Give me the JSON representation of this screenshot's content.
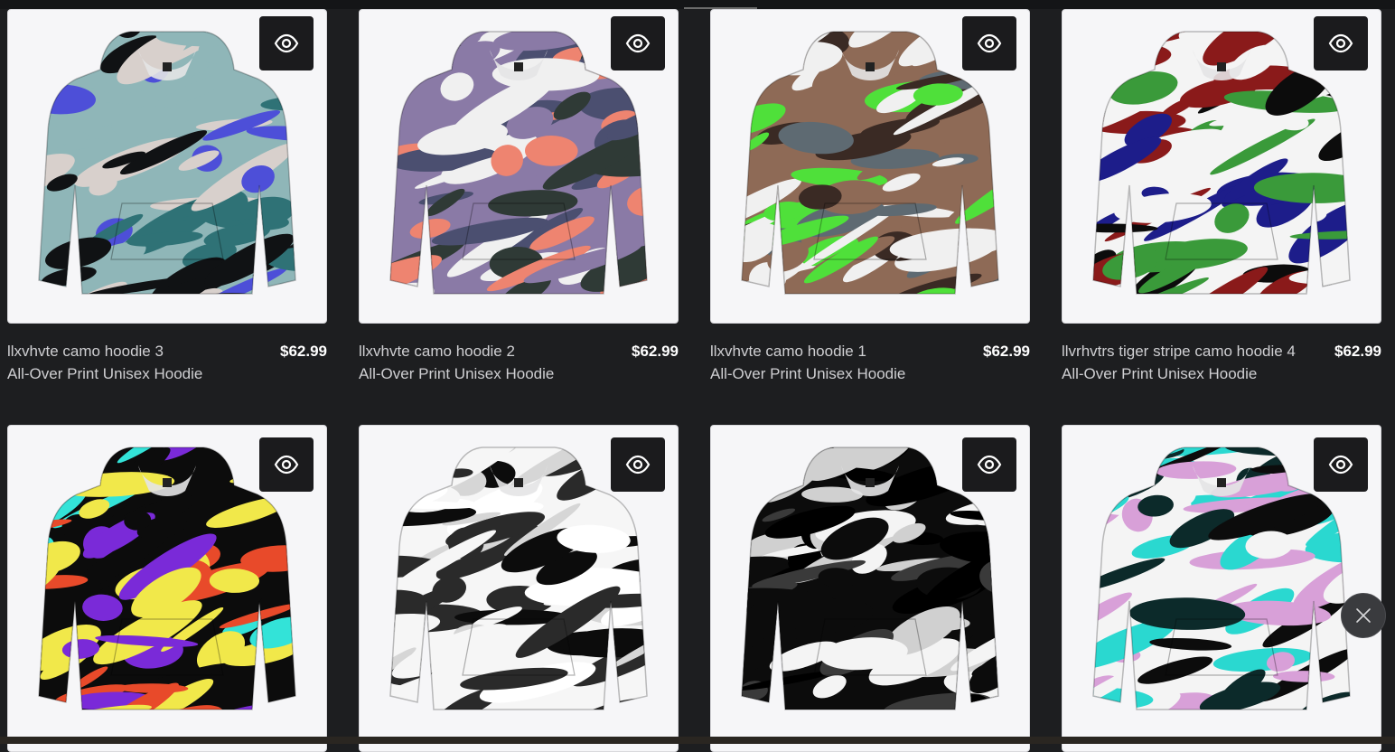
{
  "products": [
    {
      "name": "llxvhvte camo hoodie 3",
      "price": "$62.99",
      "type": "All-Over Print Unisex Hoodie",
      "colors": [
        "#8fb6b8",
        "#4d4fd8",
        "#d8d0cc",
        "#2f7276",
        "#101214"
      ]
    },
    {
      "name": "llxvhvte camo hoodie 2",
      "price": "$62.99",
      "type": "All-Over Print Unisex Hoodie",
      "colors": [
        "#8a7aa6",
        "#ee8470",
        "#2f3a36",
        "#4b4f70",
        "#f0f0f0"
      ]
    },
    {
      "name": "llxvhvte camo hoodie 1",
      "price": "$62.99",
      "type": "All-Over Print Unisex Hoodie",
      "colors": [
        "#8e6a56",
        "#4fe03a",
        "#3a2a24",
        "#5e6a72",
        "#f0f0f0"
      ]
    },
    {
      "name": "llvrhvtrs tiger stripe camo hoodie 4",
      "price": "$62.99",
      "type": "All-Over Print Unisex Hoodie",
      "colors": [
        "#f4f4f4",
        "#1d1d8a",
        "#3a9a3a",
        "#8a1a1a",
        "#0c0c0c"
      ]
    },
    {
      "name": "",
      "price": "",
      "type": "",
      "colors": [
        "#0c0c0c",
        "#f1e84a",
        "#33e3d8",
        "#7a2ad8",
        "#e84a2a"
      ]
    },
    {
      "name": "",
      "price": "",
      "type": "",
      "colors": [
        "#f6f6f6",
        "#0c0c0c",
        "#d6d6d6",
        "#2a2a2a",
        "#ffffff"
      ]
    },
    {
      "name": "",
      "price": "",
      "type": "",
      "colors": [
        "#0c0c0c",
        "#f4f4f4",
        "#3a3a3a",
        "#d0d0d0",
        "#000000"
      ]
    },
    {
      "name": "",
      "price": "",
      "type": "",
      "colors": [
        "#f4f4f4",
        "#2ad8d0",
        "#0c2a2a",
        "#d8a0d8",
        "#0c0c0c"
      ]
    }
  ],
  "icons": {
    "quick_view": "eye-icon",
    "close": "close-icon"
  }
}
